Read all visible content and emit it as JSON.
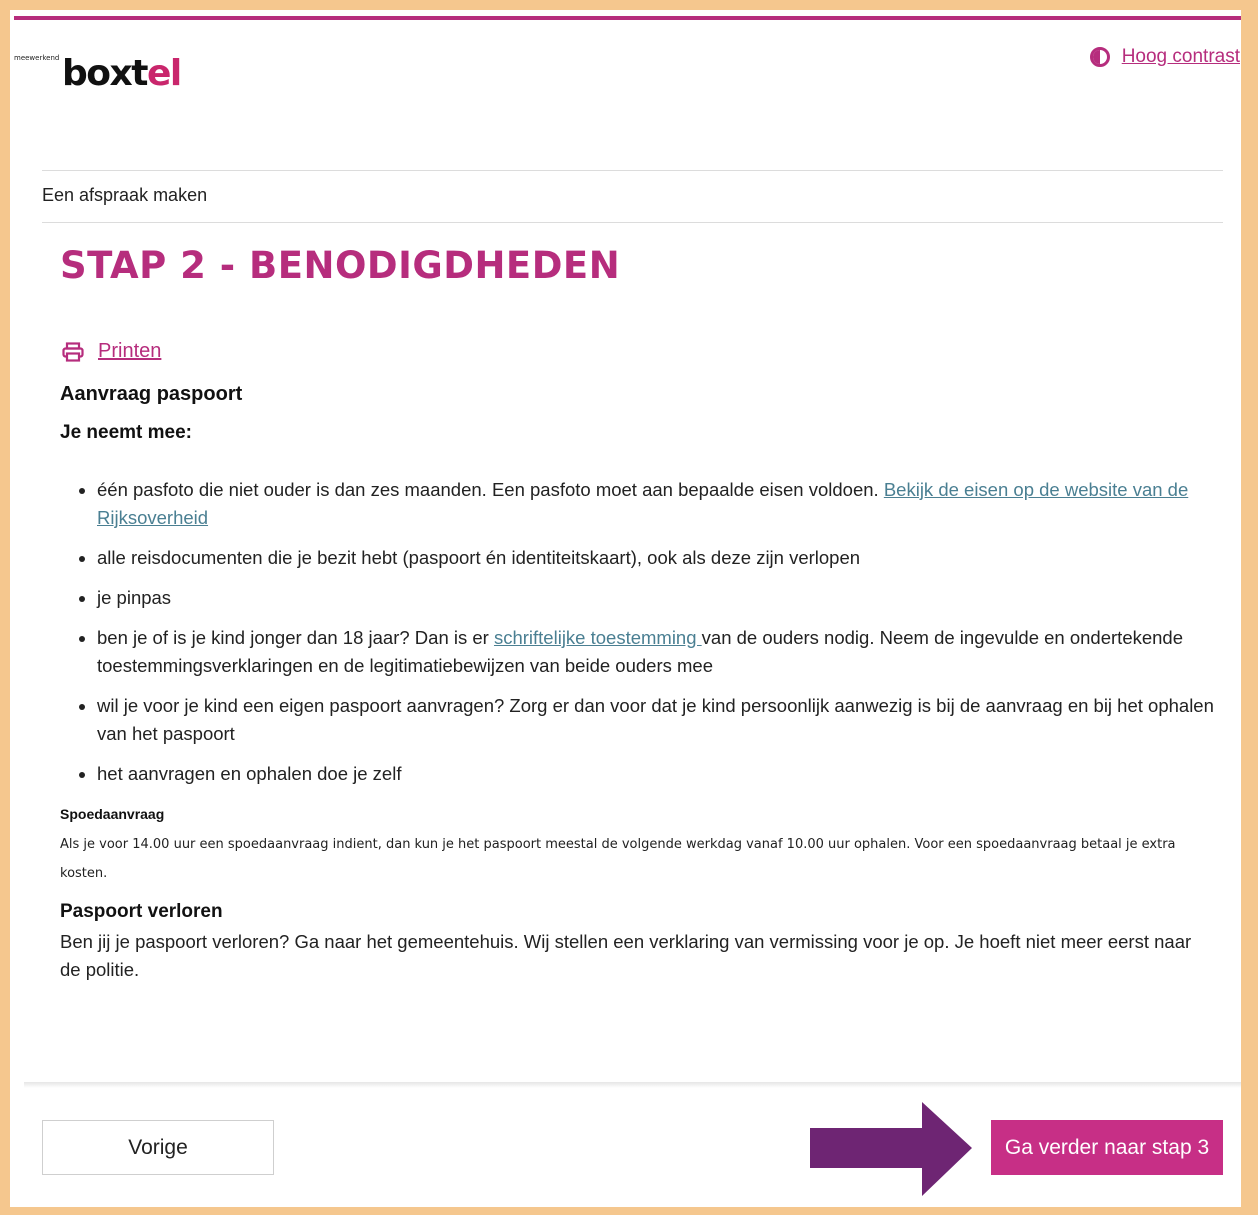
{
  "header": {
    "logo_small": "meewerkend",
    "logo_main": "boxt",
    "logo_dot": "el",
    "contrast_label": "Hoog contrast"
  },
  "breadcrumb": "Een afspraak maken",
  "page_title": "STAP 2 - BENODIGDHEDEN",
  "print_label": "Printen",
  "section": {
    "title": "Aanvraag paspoort",
    "subtitle": "Je neemt mee:",
    "items": [
      {
        "text": "één pasfoto die niet ouder is dan zes maanden. Een pasfoto moet aan bepaalde eisen voldoen. ",
        "link": "Bekijk de eisen op de website van de Rijksoverheid",
        "after": ""
      },
      {
        "text": "alle reisdocumenten die je bezit hebt (paspoort én identiteitskaart), ook als deze zijn verlopen"
      },
      {
        "text": "je pinpas"
      },
      {
        "text": "ben je of is je kind jonger dan 18 jaar? Dan is er ",
        "link": "schriftelijke toestemming ",
        "after": "van de ouders nodig.  Neem de ingevulde en ondertekende toestemmingsverklaringen en de legitimatiebewijzen van beide ouders mee"
      },
      {
        "text": "wil je voor je kind een eigen paspoort aanvragen? Zorg er dan voor dat je kind persoonlijk aanwezig is bij de aanvraag en bij het ophalen van het paspoort"
      },
      {
        "text": "het aanvragen en ophalen doe je zelf"
      }
    ]
  },
  "spoed": {
    "title": "Spoedaanvraag",
    "text": "Als je voor 14.00 uur een spoedaanvraag indient, dan kun je het paspoort meestal de volgende werkdag vanaf 10.00 uur ophalen. Voor een spoedaanvraag betaal je extra kosten."
  },
  "verloren": {
    "title": "Paspoort verloren",
    "text": "Ben jij je paspoort verloren? Ga naar het gemeentehuis. Wij stellen een verklaring van vermissing voor je op. Je hoeft niet meer eerst naar de politie."
  },
  "footer": {
    "prev_label": "Vorige",
    "next_label": "Ga verder naar stap 3"
  },
  "colors": {
    "brand": "#b62d7d",
    "button": "#c72f86",
    "link": "#4a7f92",
    "arrow": "#6e2573",
    "border": "#f5c78e"
  }
}
